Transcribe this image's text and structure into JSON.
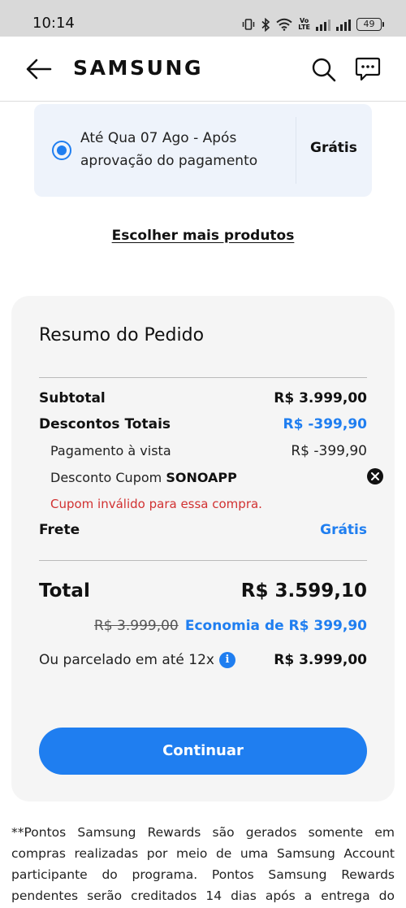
{
  "status_bar": {
    "time": "10:14",
    "volte_top": "Vo",
    "volte_bottom": "LTE",
    "battery": "49",
    "icons": [
      "vibrate-icon",
      "bluetooth-icon",
      "wifi-icon",
      "volte-icon",
      "signal-icon",
      "signal-icon",
      "battery-icon"
    ]
  },
  "header": {
    "logo": "SAMSUNG",
    "icons": [
      "back-arrow-icon",
      "search-icon",
      "chat-icon"
    ]
  },
  "delivery": {
    "option_text": "Até Qua 07 Ago - Após aprovação do pagamento",
    "price": "Grátis"
  },
  "more_products_link": "Escolher mais produtos",
  "summary": {
    "title": "Resumo do Pedido",
    "subtotal_label": "Subtotal",
    "subtotal_value": "R$ 3.999,00",
    "discounts_label": "Descontos Totais",
    "discounts_value": "R$ -399,90",
    "cash_payment_label": "Pagamento à vista",
    "cash_payment_value": "R$ -399,90",
    "coupon_label": "Desconto Cupom",
    "coupon_code": "SONOAPP",
    "coupon_error": "Cupom inválido para essa compra.",
    "shipping_label": "Frete",
    "shipping_value": "Grátis",
    "total_label": "Total",
    "total_value": "R$ 3.599,10",
    "original_price": "R$ 3.999,00",
    "savings": "Economia de R$ 399,90",
    "installments_label": "Ou parcelado em até 12x",
    "installments_value": "R$ 3.999,00",
    "continue_button": "Continuar"
  },
  "footnote": "**Pontos Samsung Rewards são gerados somente em compras realizadas por meio de uma Samsung Account participante do programa. Pontos Samsung Rewards pendentes serão creditados 14 dias após a entrega do pedido. Caso seu pedido",
  "colors": {
    "accent": "#1f7ef0",
    "error": "#d13131",
    "card_background": "#f5f5f5",
    "delivery_background": "#eef3fb"
  }
}
